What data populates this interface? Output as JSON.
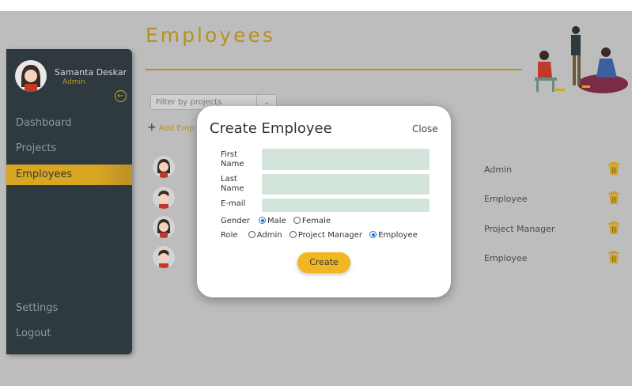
{
  "user": {
    "name": "Samanta Deskar",
    "role": "Admin"
  },
  "nav": {
    "items": [
      {
        "label": "Dashboard"
      },
      {
        "label": "Projects"
      },
      {
        "label": "Employees",
        "active": true
      }
    ],
    "bottom": [
      {
        "label": "Settings"
      },
      {
        "label": "Logout"
      }
    ]
  },
  "page": {
    "title": "Employees",
    "filter_placeholder": "Filter by projects",
    "add_label": "Add Emp"
  },
  "employees": [
    {
      "role": "Admin",
      "avatar": "female-avatar"
    },
    {
      "role": "Employee",
      "avatar": "male-avatar"
    },
    {
      "role": "Project Manager",
      "avatar": "female-avatar"
    },
    {
      "role": "Employee",
      "avatar": "male-avatar"
    }
  ],
  "modal": {
    "title": "Create Employee",
    "close_label": "Close",
    "fields": {
      "first_name_label": "First Name",
      "last_name_label": "Last Name",
      "email_label": "E-mail",
      "first_name_value": "",
      "last_name_value": "",
      "email_value": ""
    },
    "gender": {
      "label": "Gender",
      "options": [
        "Male",
        "Female"
      ],
      "selected": "Male"
    },
    "role": {
      "label": "Role",
      "options": [
        "Admin",
        "Project Manager",
        "Employee"
      ],
      "selected": "Employee"
    },
    "create_label": "Create"
  },
  "colors": {
    "accent": "#f2b622",
    "sidebar": "#2f3a40",
    "title": "#b8901f",
    "input_bg": "#d3e4da",
    "radio_selected": "#2a6fd6"
  },
  "icons": {
    "collapse": "arrow-left-circle-icon",
    "add": "plus-icon",
    "delete": "trash-icon",
    "filter_dropdown": "chevron-down-icon"
  }
}
